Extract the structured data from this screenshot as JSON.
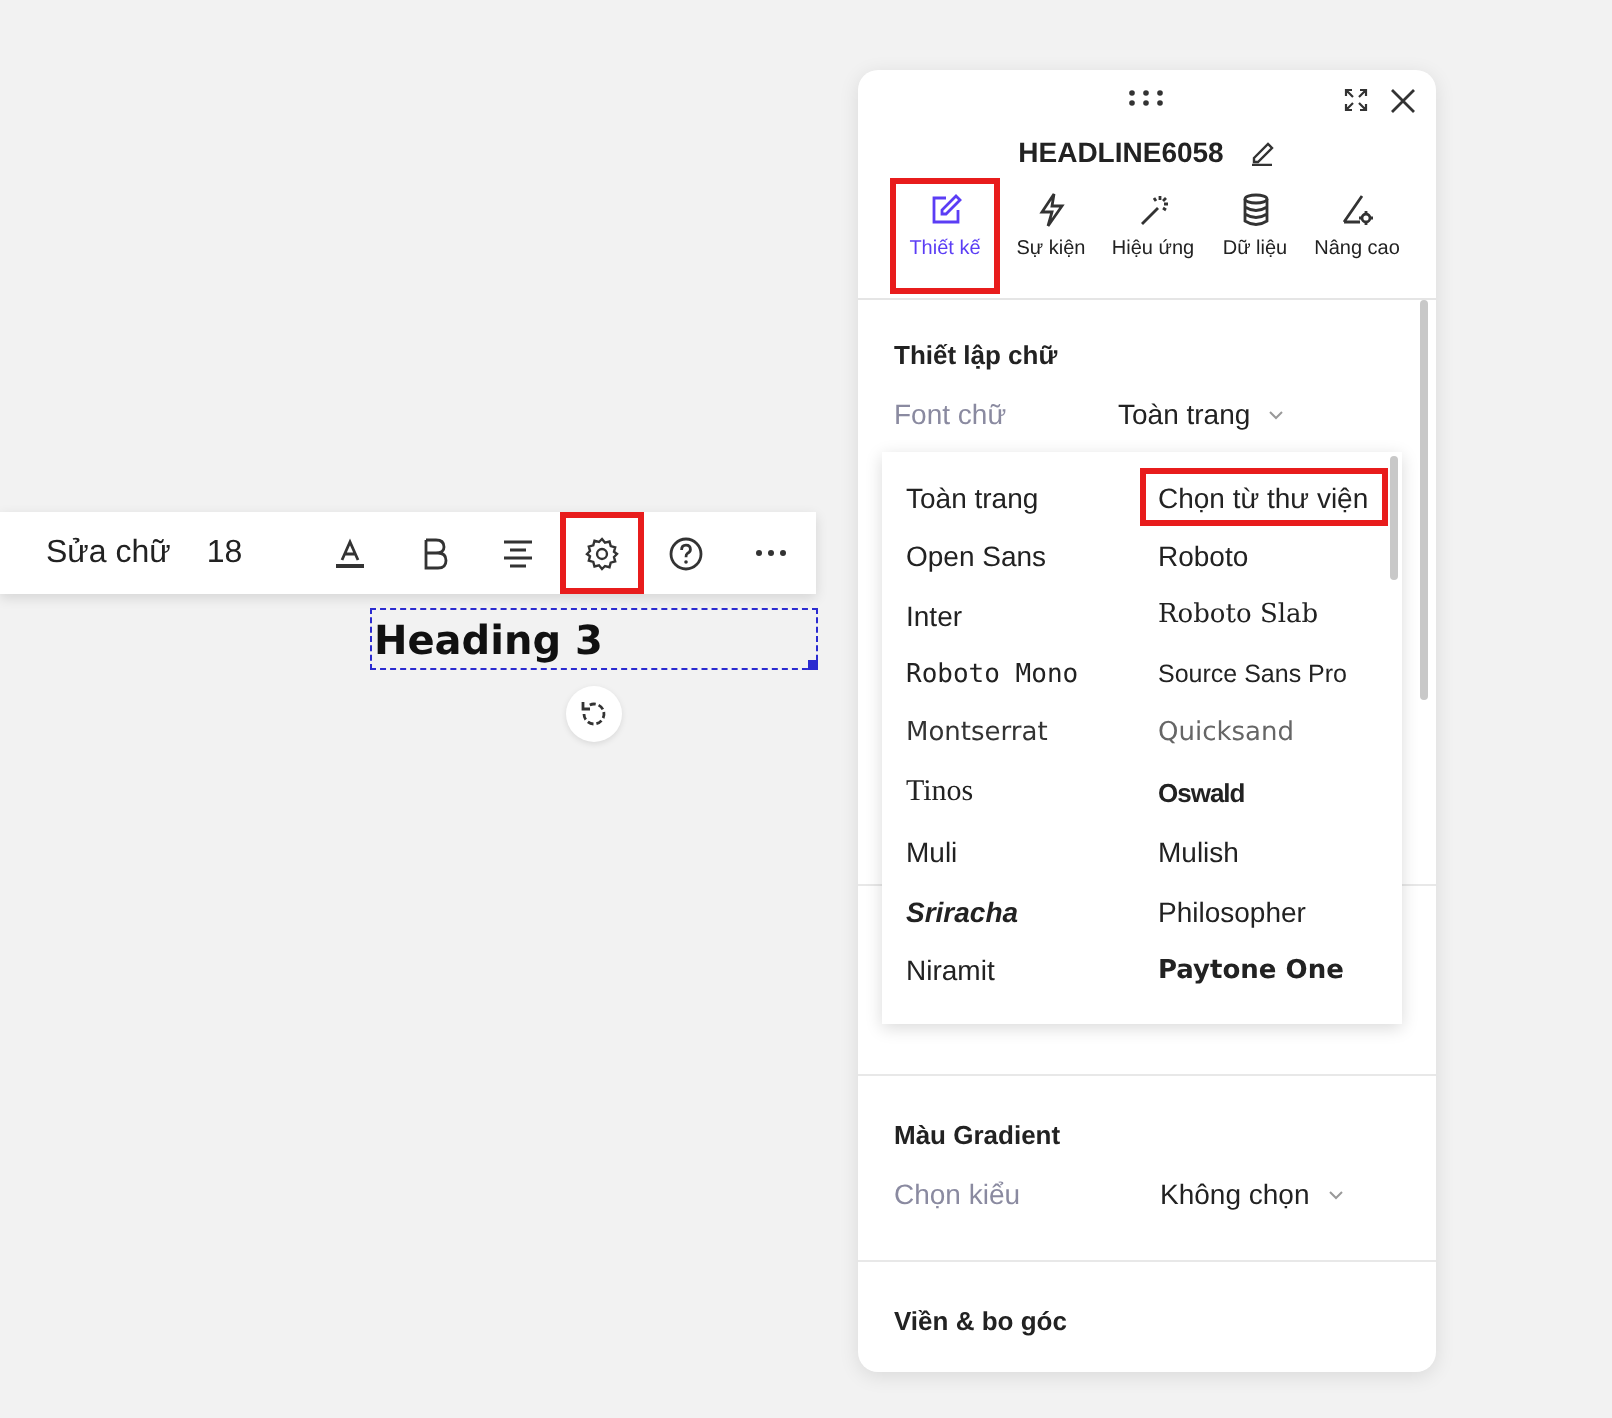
{
  "toolbar": {
    "items": [
      {
        "kind": "text",
        "label": "Sửa chữ",
        "highlighted": false
      },
      {
        "kind": "text",
        "label": "18",
        "highlighted": false
      },
      {
        "kind": "text-color",
        "highlighted": false
      },
      {
        "kind": "bold",
        "highlighted": false
      },
      {
        "kind": "align",
        "highlighted": false
      },
      {
        "kind": "settings",
        "highlighted": true
      },
      {
        "kind": "help",
        "highlighted": false
      },
      {
        "kind": "more",
        "highlighted": false
      }
    ]
  },
  "element": {
    "text": "Heading 3"
  },
  "panel": {
    "title": "HEADLINE6058",
    "tabs": [
      {
        "label": "Thiết kế",
        "kind": "edit",
        "selected": true,
        "highlighted": true
      },
      {
        "label": "Sự kiện",
        "kind": "bolt",
        "selected": false,
        "highlighted": false
      },
      {
        "label": "Hiệu ứng",
        "kind": "wand",
        "selected": false,
        "highlighted": false
      },
      {
        "label": "Dữ liệu",
        "kind": "database",
        "selected": false,
        "highlighted": false
      },
      {
        "label": "Nâng cao",
        "kind": "advanced",
        "selected": false,
        "highlighted": false
      }
    ],
    "sections": [
      {
        "title": "Thiết lập chữ",
        "rows": [
          {
            "label": "Font chữ",
            "value": "Toàn trang"
          }
        ]
      },
      {
        "title": "Màu Gradient",
        "rows": [
          {
            "label": "Chọn kiểu",
            "value": "Không chọn"
          }
        ]
      },
      {
        "title": "Viền & bo góc"
      }
    ]
  },
  "font_dropdown": {
    "options": [
      {
        "label": "Toàn trang",
        "kind": "sans",
        "highlighted": false
      },
      {
        "label": "Chọn từ thư viện",
        "kind": "sans",
        "highlighted": true
      },
      {
        "label": "Open Sans",
        "kind": "sans",
        "highlighted": false
      },
      {
        "label": "Roboto",
        "kind": "sans",
        "highlighted": false
      },
      {
        "label": "Inter",
        "kind": "sans",
        "highlighted": false
      },
      {
        "label": "Roboto Slab",
        "kind": "slab",
        "highlighted": false
      },
      {
        "label": "Roboto Mono",
        "kind": "mono",
        "highlighted": false
      },
      {
        "label": "Source Sans Pro",
        "kind": "narrow",
        "highlighted": false
      },
      {
        "label": "Montserrat",
        "kind": "wide",
        "highlighted": false
      },
      {
        "label": "Quicksand",
        "kind": "light",
        "highlighted": false
      },
      {
        "label": "Tinos",
        "kind": "serif",
        "highlighted": false
      },
      {
        "label": "Oswald",
        "kind": "condensed",
        "highlighted": false
      },
      {
        "label": "Muli",
        "kind": "sans",
        "highlighted": false
      },
      {
        "label": "Mulish",
        "kind": "sans",
        "highlighted": false
      },
      {
        "label": "Sriracha",
        "kind": "italic",
        "highlighted": false
      },
      {
        "label": "Philosopher",
        "kind": "sans",
        "highlighted": false
      },
      {
        "label": "Niramit",
        "kind": "sans",
        "highlighted": false
      },
      {
        "label": "Paytone One",
        "kind": "heavy",
        "highlighted": false
      }
    ]
  }
}
